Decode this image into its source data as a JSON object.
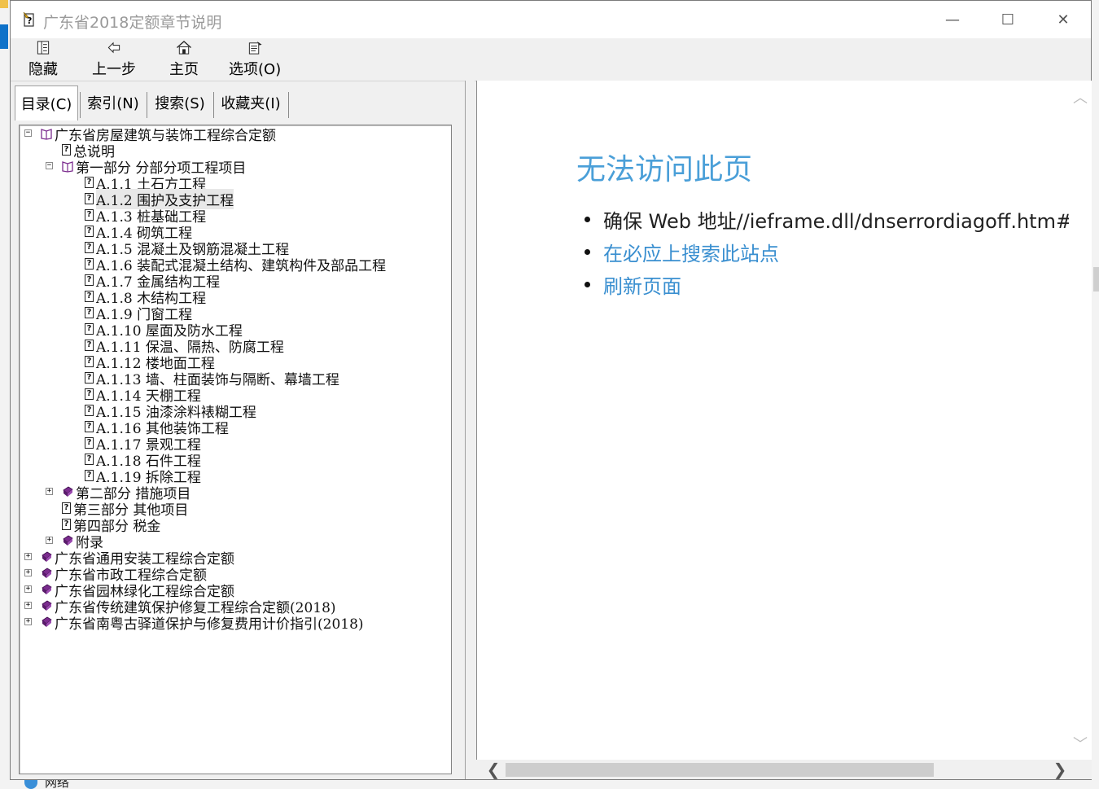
{
  "window": {
    "title": "广东省2018定额章节说明",
    "min_glyph": "—",
    "max_glyph": "☐",
    "close_glyph": "✕"
  },
  "toolbar": {
    "buttons": [
      {
        "label": "隐藏",
        "icon": "hide-icon"
      },
      {
        "label": "上一步",
        "icon": "back-arrow-icon"
      },
      {
        "label": "主页",
        "icon": "home-icon"
      },
      {
        "label": "选项(O)",
        "icon": "options-icon"
      }
    ]
  },
  "tabs": [
    {
      "label": "目录(C)",
      "active": true
    },
    {
      "label": "索引(N)",
      "active": false
    },
    {
      "label": "搜索(S)",
      "active": false
    },
    {
      "label": "收藏夹(I)",
      "active": false
    }
  ],
  "tree": [
    {
      "label": "广东省房屋建筑与装饰工程综合定额",
      "level": 0,
      "type": "book-open",
      "expander": "−"
    },
    {
      "label": "总说明",
      "level": 1,
      "type": "page",
      "expander": ""
    },
    {
      "label": "第一部分 分部分项工程项目",
      "level": 1,
      "type": "book-open",
      "expander": "−"
    },
    {
      "label": "A.1.1 土石方工程",
      "level": 2,
      "type": "page",
      "expander": ""
    },
    {
      "label": "A.1.2 围护及支护工程",
      "level": 2,
      "type": "page",
      "expander": "",
      "selected": true
    },
    {
      "label": "A.1.3 桩基础工程",
      "level": 2,
      "type": "page",
      "expander": ""
    },
    {
      "label": "A.1.4 砌筑工程",
      "level": 2,
      "type": "page",
      "expander": ""
    },
    {
      "label": "A.1.5 混凝土及钢筋混凝土工程",
      "level": 2,
      "type": "page",
      "expander": ""
    },
    {
      "label": "A.1.6 装配式混凝土结构、建筑构件及部品工程",
      "level": 2,
      "type": "page",
      "expander": ""
    },
    {
      "label": "A.1.7 金属结构工程",
      "level": 2,
      "type": "page",
      "expander": ""
    },
    {
      "label": "A.1.8 木结构工程",
      "level": 2,
      "type": "page",
      "expander": ""
    },
    {
      "label": "A.1.9 门窗工程",
      "level": 2,
      "type": "page",
      "expander": ""
    },
    {
      "label": "A.1.10 屋面及防水工程",
      "level": 2,
      "type": "page",
      "expander": ""
    },
    {
      "label": "A.1.11 保温、隔热、防腐工程",
      "level": 2,
      "type": "page",
      "expander": ""
    },
    {
      "label": "A.1.12 楼地面工程",
      "level": 2,
      "type": "page",
      "expander": ""
    },
    {
      "label": "A.1.13 墙、柱面装饰与隔断、幕墙工程",
      "level": 2,
      "type": "page",
      "expander": ""
    },
    {
      "label": "A.1.14 天棚工程",
      "level": 2,
      "type": "page",
      "expander": ""
    },
    {
      "label": "A.1.15 油漆涂料裱糊工程",
      "level": 2,
      "type": "page",
      "expander": ""
    },
    {
      "label": "A.1.16 其他装饰工程",
      "level": 2,
      "type": "page",
      "expander": ""
    },
    {
      "label": "A.1.17 景观工程",
      "level": 2,
      "type": "page",
      "expander": ""
    },
    {
      "label": "A.1.18 石件工程",
      "level": 2,
      "type": "page",
      "expander": ""
    },
    {
      "label": "A.1.19 拆除工程",
      "level": 2,
      "type": "page",
      "expander": ""
    },
    {
      "label": "第二部分 措施项目",
      "level": 1,
      "type": "book",
      "expander": "+"
    },
    {
      "label": "第三部分 其他项目",
      "level": 1,
      "type": "page",
      "expander": ""
    },
    {
      "label": "第四部分 税金",
      "level": 1,
      "type": "page",
      "expander": ""
    },
    {
      "label": "附录",
      "level": 1,
      "type": "book",
      "expander": "+"
    },
    {
      "label": "广东省通用安装工程综合定额",
      "level": 0,
      "type": "book",
      "expander": "+"
    },
    {
      "label": "广东省市政工程综合定额",
      "level": 0,
      "type": "book",
      "expander": "+"
    },
    {
      "label": "广东省园林绿化工程综合定额",
      "level": 0,
      "type": "book",
      "expander": "+"
    },
    {
      "label": "广东省传统建筑保护修复工程综合定额(2018)",
      "level": 0,
      "type": "book",
      "expander": "+"
    },
    {
      "label": "广东省南粤古驿道保护与修复费用计价指引(2018)",
      "level": 0,
      "type": "book",
      "expander": "+"
    }
  ],
  "content": {
    "title": "无法访问此页",
    "items": [
      {
        "text": "确保 Web 地址//ieframe.dll/dnserrordiagoff.htm# 正",
        "link": false
      },
      {
        "text": "在必应上搜索此站点",
        "link": true
      },
      {
        "text": "刷新页面",
        "link": true
      }
    ]
  },
  "scroll": {
    "up": "︿",
    "down": "﹀",
    "left": "❮",
    "right": "❯"
  },
  "desktop": {
    "taskbar_label": "网络"
  },
  "colors": {
    "link": "#3a8fd0",
    "title": "#4a9fd8",
    "book": "#7b2c8e"
  }
}
